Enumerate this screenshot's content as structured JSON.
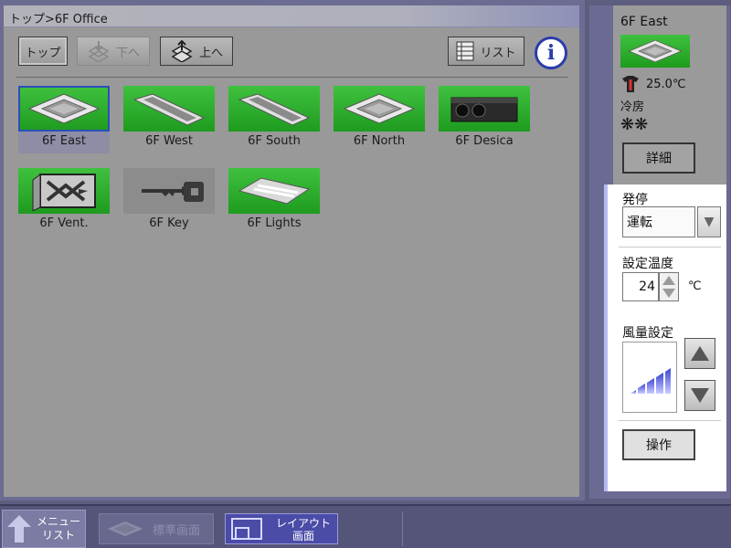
{
  "breadcrumb": "トップ>6F Office",
  "toolbar": {
    "top_label": "トップ",
    "down_label": "下へ",
    "up_label": "上へ",
    "list_label": "リスト",
    "info_symbol": "i"
  },
  "devices": [
    {
      "label": "6F East",
      "icon": "cassette-ac-icon",
      "status": "on",
      "selected": true
    },
    {
      "label": "6F West",
      "icon": "slim-duct-icon",
      "status": "on"
    },
    {
      "label": "6F South",
      "icon": "slim-duct-icon",
      "status": "on"
    },
    {
      "label": "6F North",
      "icon": "cassette-ac-icon",
      "status": "on"
    },
    {
      "label": "6F Desica",
      "icon": "desica-unit-icon",
      "status": "on"
    },
    {
      "label": "6F Vent.",
      "icon": "ventilation-icon",
      "status": "on"
    },
    {
      "label": "6F Key",
      "icon": "key-icon",
      "status": "off"
    },
    {
      "label": "6F Lights",
      "icon": "light-fixture-icon",
      "status": "on"
    }
  ],
  "side": {
    "device_name": "6F East",
    "current_temp": "25.0℃",
    "mode": "冷房",
    "detail_label": "詳細"
  },
  "control": {
    "onoff_label": "発停",
    "onoff_value": "運転",
    "setpoint_label": "設定温度",
    "setpoint_value": "24",
    "setpoint_unit": "℃",
    "fan_label": "風量設定",
    "operate_label": "操作"
  },
  "bottom": {
    "menu_line1": "メニュー",
    "menu_line2": "リスト",
    "standard_label": "標準画面",
    "layout_line1": "レイアウト",
    "layout_line2": "画面"
  },
  "colors": {
    "device_on": "#2fb12f",
    "device_off": "#8c8c8c",
    "selection": "#2d4eb8",
    "fan_bars": "#5a6ae0"
  }
}
